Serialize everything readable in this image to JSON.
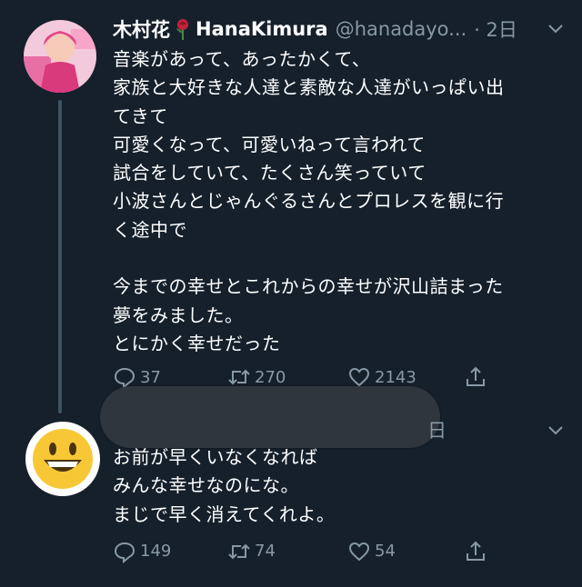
{
  "tweet1": {
    "display_name": "木村花",
    "display_name_suffix": "HanaKimura",
    "handle": "@hanadayo...",
    "time": "· 2日",
    "lines": [
      "音楽があって、あったかくて、",
      "家族と大好きな人達と素敵な人達がいっぱい出",
      "てきて",
      "可愛くなって、可愛いねって言われて",
      "試合をしていて、たくさん笑っていて",
      "小波さんとじゃんぐるさんとプロレスを観に行",
      "く途中で",
      "",
      "今までの幸せとこれからの幸せが沢山詰まった",
      "夢をみました。",
      "とにかく幸せだった"
    ],
    "replies": "37",
    "retweets": "270",
    "likes": "2143"
  },
  "tweet2": {
    "time_fragment": "日",
    "lines": [
      "お前が早くいなくなれば",
      "みんな幸せなのにな。",
      "まじで早く消えてくれよ。"
    ],
    "replies": "149",
    "retweets": "74",
    "likes": "54"
  },
  "icons": {
    "reply": "reply-icon",
    "retweet": "retweet-icon",
    "like": "heart-icon",
    "share": "share-icon",
    "more": "chevron-down-icon",
    "emoji": "smiling-face-emoji"
  },
  "colors": {
    "background": "#15202b",
    "text": "#ffffff",
    "muted": "#8899a6",
    "thread_line": "#3d5466",
    "redaction": "#30363d"
  }
}
